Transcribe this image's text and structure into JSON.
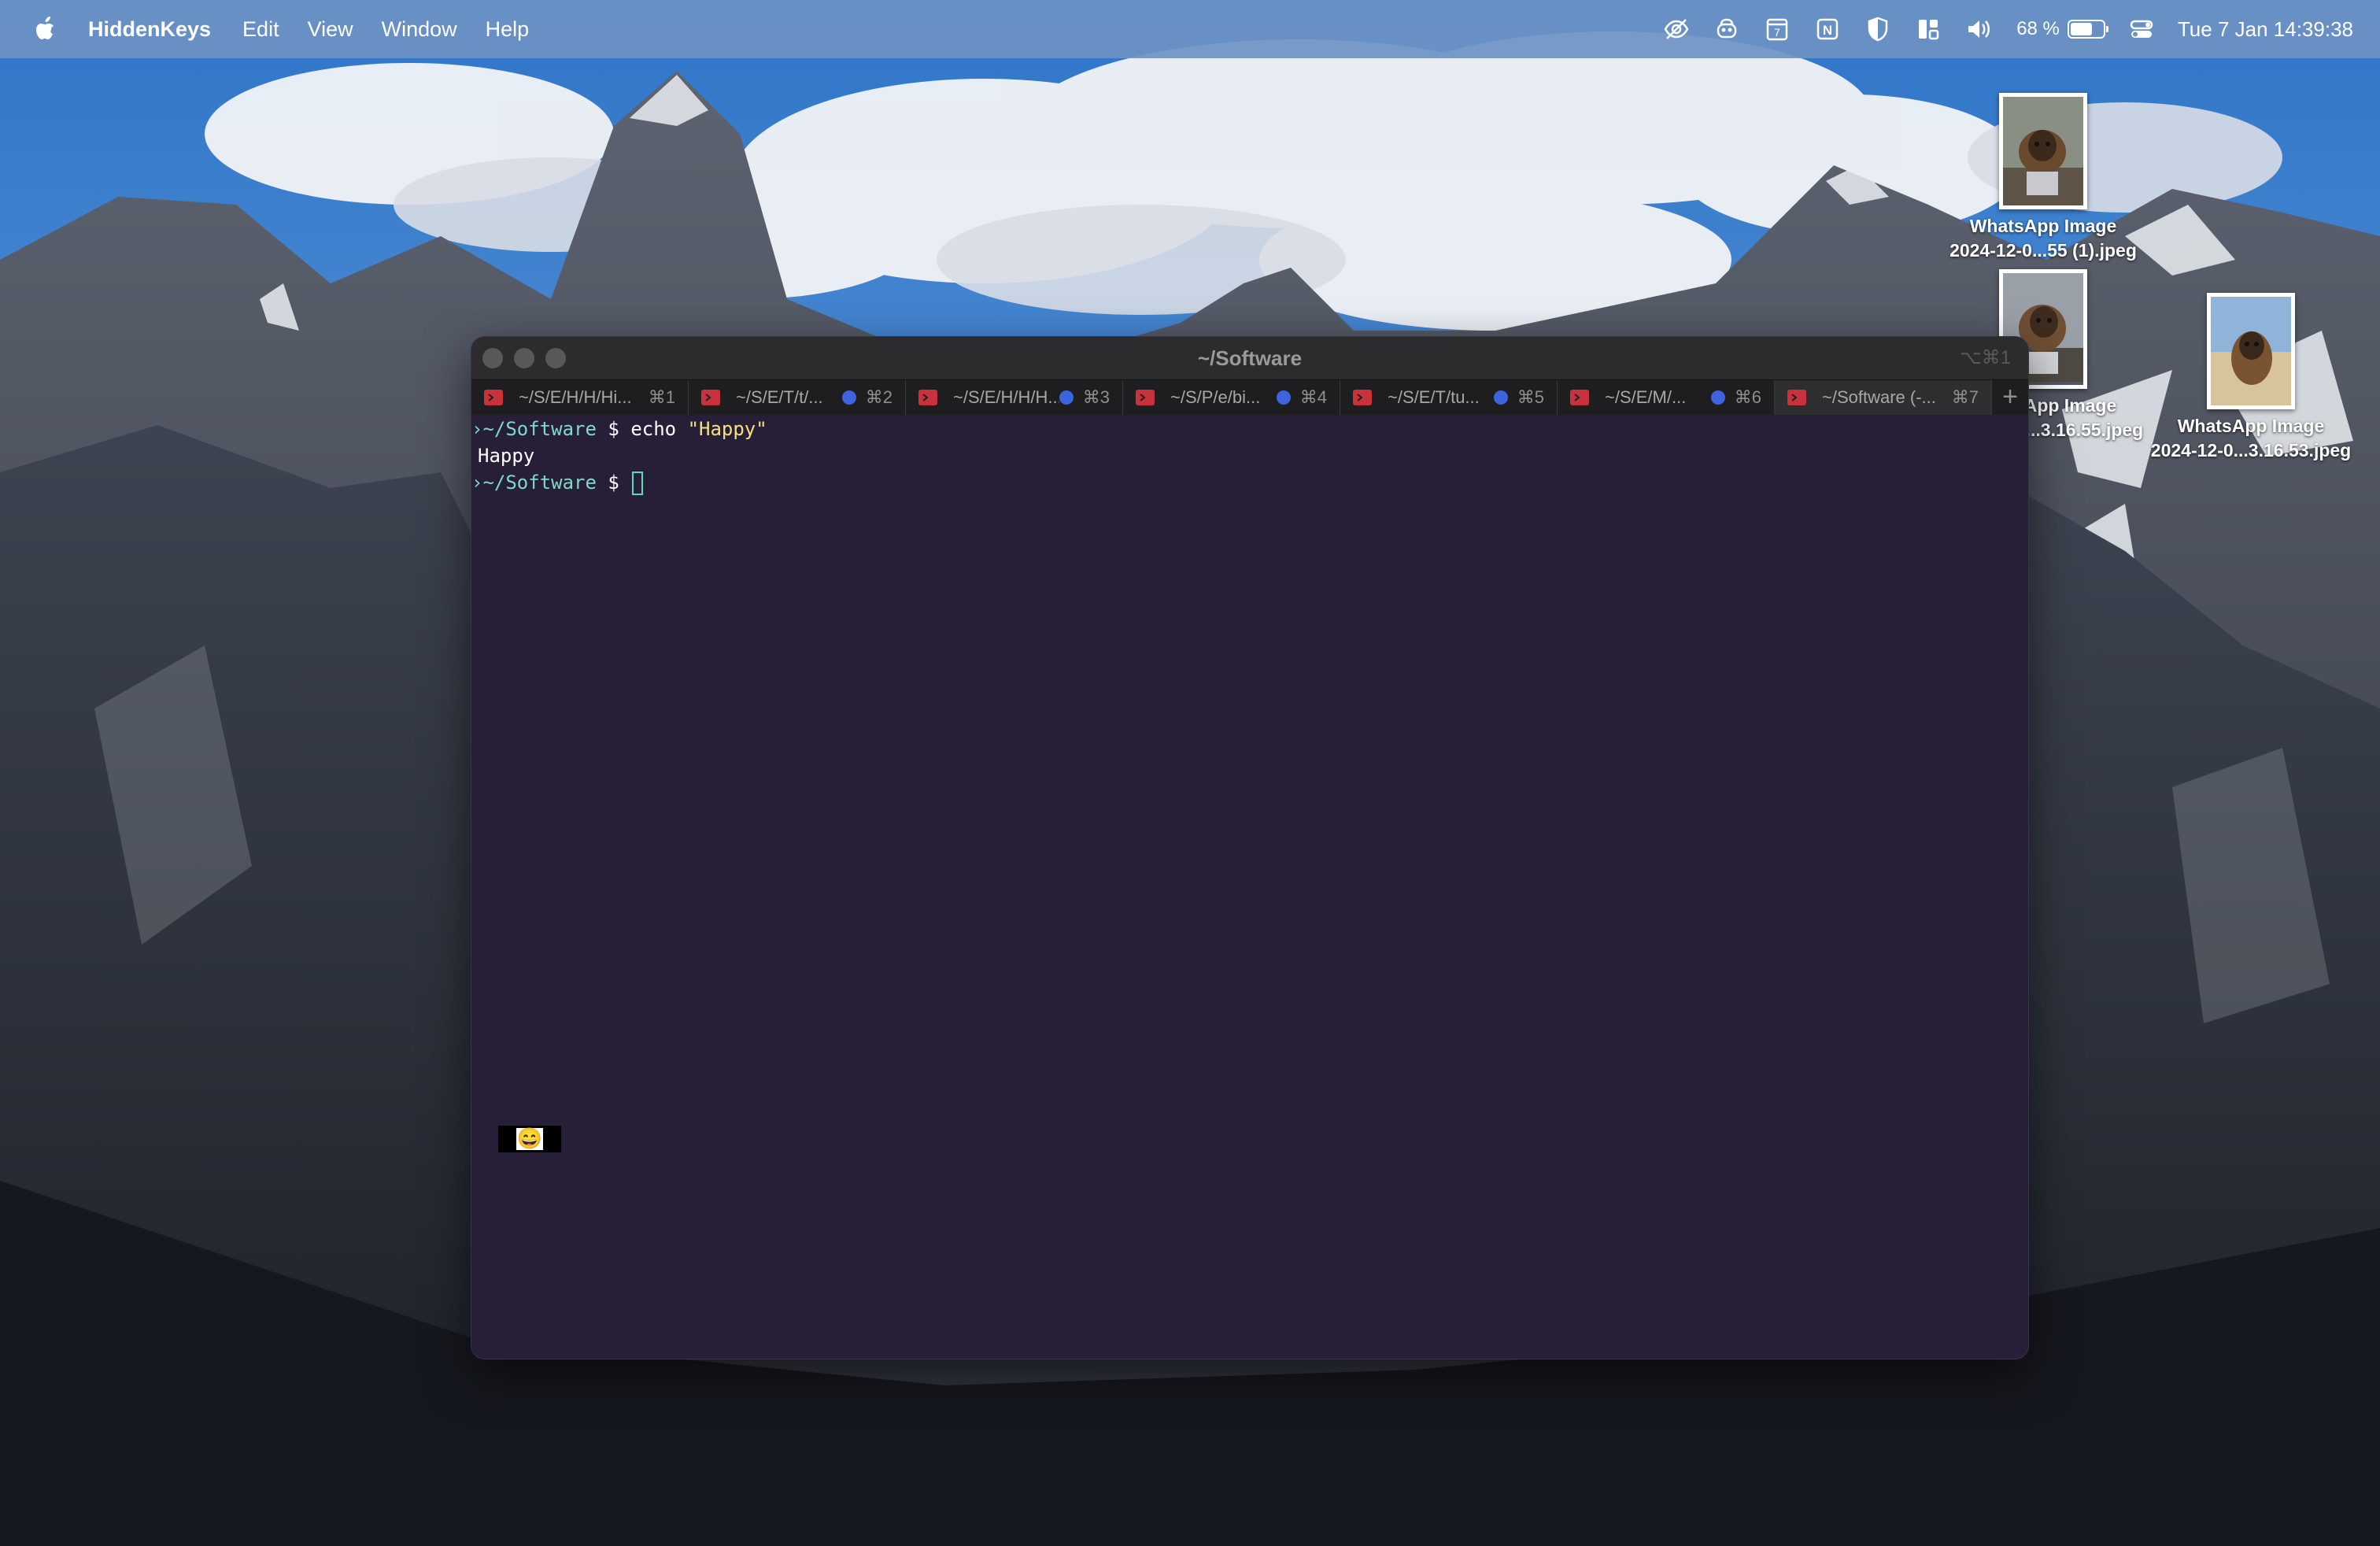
{
  "menubar": {
    "app_name": "HiddenKeys",
    "items": [
      "Edit",
      "View",
      "Window",
      "Help"
    ],
    "calendar_day": "7",
    "notion_letter": "N",
    "battery_text": "68 %",
    "battery_level": 0.68,
    "clock": "Tue 7 Jan  14:39:38"
  },
  "desktop_icons": [
    {
      "line1": "WhatsApp Image",
      "line2": "2024-12-0...55 (1).jpeg"
    },
    {
      "line1": "WhatsApp Image",
      "line2": "2024-12-0...3.16.55.jpeg"
    },
    {
      "line1": "WhatsApp Image",
      "line2": "2024-12-0...3.16.53.jpeg"
    }
  ],
  "terminal": {
    "title": "~/Software",
    "title_shortcut": "⌥⌘1",
    "tabs": [
      {
        "label": "~/S/E/H/H/Hi...",
        "shortcut": "⌘1",
        "dot": false
      },
      {
        "label": "~/S/E/T/t/...",
        "shortcut": "⌘2",
        "dot": true
      },
      {
        "label": "~/S/E/H/H/H...",
        "shortcut": "⌘3",
        "dot": true
      },
      {
        "label": "~/S/P/e/bi...",
        "shortcut": "⌘4",
        "dot": true
      },
      {
        "label": "~/S/E/T/tu...",
        "shortcut": "⌘5",
        "dot": true
      },
      {
        "label": "~/S/E/M/...",
        "shortcut": "⌘6",
        "dot": true
      },
      {
        "label": "~/Software (-...",
        "shortcut": "⌘7",
        "dot": false
      }
    ],
    "new_tab": "+",
    "lines": {
      "l1_path": "~/Software",
      "l1_sym": " $ ",
      "l1_cmd": "echo ",
      "l1_str": "\"Happy\"",
      "l2_output": "Happy",
      "l3_path": "~/Software",
      "l3_sym": " $ "
    },
    "emoji": "😄"
  },
  "colors": {
    "terminal_bg": "#271e38",
    "prompt": "#7fd9c5",
    "string": "#f5e27a",
    "tab_dot": "#3c64dd",
    "tab_icon": "#c8323c"
  }
}
